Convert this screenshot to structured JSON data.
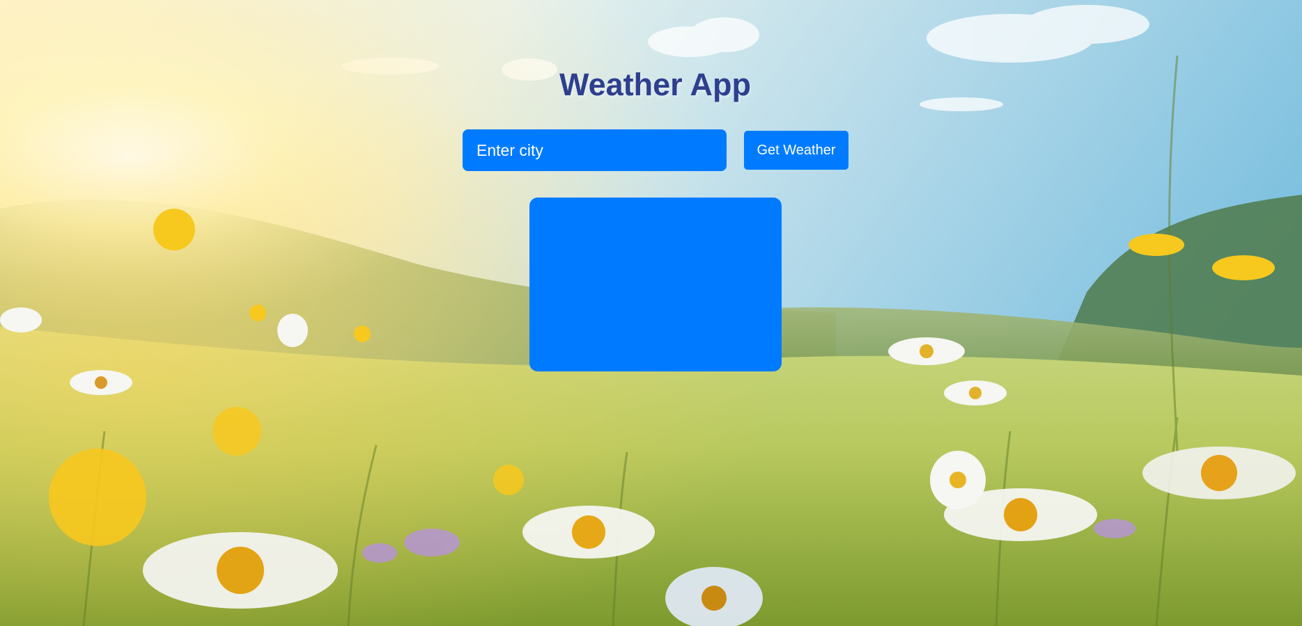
{
  "app": {
    "title": "Weather App"
  },
  "search": {
    "placeholder": "Enter city",
    "value": ""
  },
  "actions": {
    "get_weather_label": "Get Weather"
  },
  "colors": {
    "accent": "#007bff",
    "title": "#2e3f8f"
  },
  "background": {
    "icon": "meadow-flowers-sunlight-image"
  }
}
